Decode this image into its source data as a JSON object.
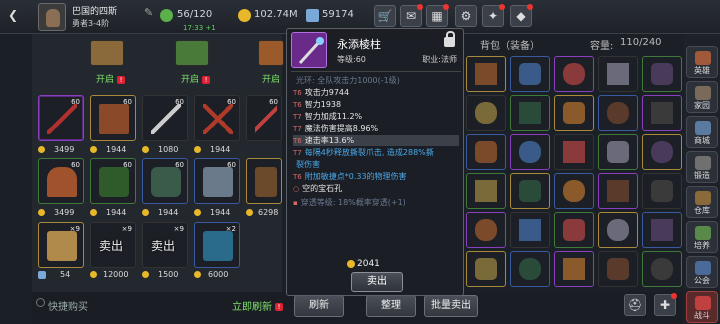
{
  "player": {
    "name": "巴国的四斯",
    "title": "勇者3-4阶"
  },
  "stamina": {
    "value": "56/120",
    "timer": "17:33 +1"
  },
  "gold": "102.74M",
  "gems": "59174",
  "left": {
    "chests": [
      {
        "label": "开启"
      },
      {
        "label": "开启"
      },
      {
        "label": "开启"
      }
    ],
    "rows": [
      [
        {
          "count": "60",
          "price": "3499"
        },
        {
          "count": "60",
          "price": "1944"
        },
        {
          "count": "60",
          "price": "1080"
        },
        {
          "count": "60",
          "price": "1944"
        },
        {
          "count": "60",
          "price": ""
        }
      ],
      [
        {
          "count": "60",
          "price": "3499"
        },
        {
          "count": "60",
          "price": "1944"
        },
        {
          "count": "60",
          "price": "1944"
        },
        {
          "count": "60",
          "price": "1944"
        },
        {
          "count": "",
          "price": "6298"
        }
      ],
      [
        {
          "count": "",
          "price": "1080"
        },
        {
          "count": "60",
          "price": "1944"
        },
        {
          "count": "60",
          "price": "1944"
        },
        {
          "count": "60",
          "price": "1944"
        },
        {
          "count": "60",
          "price": "6298"
        }
      ]
    ],
    "bottom": [
      {
        "count": "×9",
        "price": "54",
        "sold": ""
      },
      {
        "count": "×9",
        "price": "12000",
        "sold": "卖出"
      },
      {
        "count": "×9",
        "price": "1500",
        "sold": "卖出"
      },
      {
        "count": "×2",
        "price": "6000",
        "sold": ""
      }
    ]
  },
  "bottombar": {
    "quickbuy": "快捷购买",
    "refresh_label": "立即刷新",
    "refresh_btn": "刷新",
    "sort_btn": "整理",
    "bulk_btn": "批量卖出"
  },
  "bag": {
    "title": "背包（装备）",
    "capacity_label": "容量:",
    "capacity": "110/240"
  },
  "tooltip": {
    "name": "永添棱柱",
    "level": "等级:60",
    "class": "职业:法师",
    "lines": [
      {
        "tag": "",
        "text": "光环: 全队攻击力1000(-1级)",
        "style": "dim"
      },
      {
        "tag": "T6",
        "text": "攻击力9744",
        "style": ""
      },
      {
        "tag": "T6",
        "text": "智力1938",
        "style": ""
      },
      {
        "tag": "T7",
        "text": "智力加成11.2%",
        "style": ""
      },
      {
        "tag": "T7",
        "text": "魔法伤害提高8.96%",
        "style": ""
      },
      {
        "tag": "T6",
        "text": "速击率13.6%",
        "style": "sel"
      },
      {
        "tag": "T7",
        "text": "每隔4秒释放撕裂爪击, 造成288%撕",
        "style": "blue"
      },
      {
        "tag": "",
        "text": "裂伤害",
        "style": "blue"
      },
      {
        "tag": "T6",
        "text": "附加敏捷点*0.33的物理伤害",
        "style": "blue"
      },
      {
        "tag": "○",
        "text": "空的宝石孔",
        "style": ""
      },
      {
        "tag": "▪",
        "text": "穿透等级: 18%概率穿透(+1)",
        "style": "dim"
      }
    ],
    "price": "2041",
    "sell": "卖出"
  },
  "sidebar": [
    {
      "label": "英雄"
    },
    {
      "label": "家园"
    },
    {
      "label": "商城"
    },
    {
      "label": "锻造"
    },
    {
      "label": "仓库"
    },
    {
      "label": "培养"
    },
    {
      "label": "公会"
    },
    {
      "label": "战斗"
    }
  ]
}
